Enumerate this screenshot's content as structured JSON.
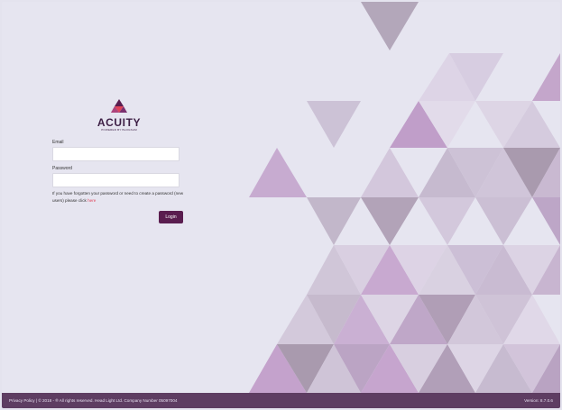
{
  "brand": {
    "name": "ACUITY",
    "tagline": "POWERED BY BLOGSAM",
    "colors": {
      "accent": "#5a1d4f",
      "logo_top": "#5a1d4f",
      "logo_mid": "#e0445a",
      "logo_bottom": "#7a2f6f"
    }
  },
  "login": {
    "email_label": "Email",
    "email_value": "",
    "password_label": "Password",
    "password_value": "",
    "forgot_text": "If you have forgotten your password or need to create a password (new users) please click",
    "forgot_link": "here",
    "login_button": "Login"
  },
  "footer": {
    "left_text": "Privacy Policy | © 2018 - ® All rights reserved. Head Light Ltd. Company Number 05097004",
    "version": "Version: 8.7.0.6"
  },
  "theme": {
    "background": "#e6e5f0",
    "footer": "#5e3d62",
    "triangle_colors": [
      "#b3a7ba",
      "#c9a6cf",
      "#d7cde1",
      "#c4b9cd",
      "#b499bc",
      "#ddd4e6",
      "#a99aae"
    ]
  }
}
